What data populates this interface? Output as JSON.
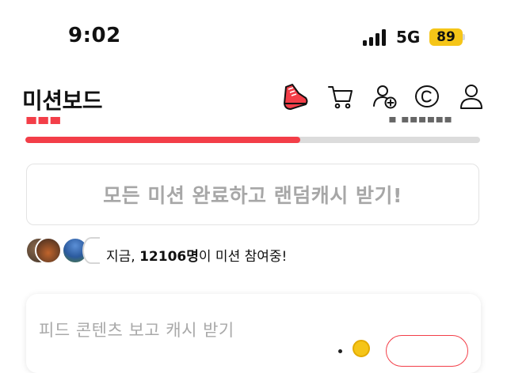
{
  "status_bar": {
    "time": "9:02",
    "network": "5G",
    "battery": "89"
  },
  "header": {
    "title": "미션보드",
    "icons": [
      "sneaker-icon",
      "cart-icon",
      "add-friend-icon",
      "cash-coin-icon",
      "profile-icon"
    ]
  },
  "progress": {
    "fraction": 0.605,
    "fill_color": "#f33e48",
    "track_color": "#dcdcdc"
  },
  "complete_all": {
    "label": "모든 미션 완료하고 랜덤캐시 받기!"
  },
  "participants": {
    "prefix": "지금, ",
    "count": "12106명",
    "suffix": "이 미션 참여중!"
  },
  "feed_card": {
    "title": "피드 콘텐츠 보고 캐시 받기"
  },
  "colors": {
    "accent": "#f33e48",
    "battery": "#f5c518"
  }
}
